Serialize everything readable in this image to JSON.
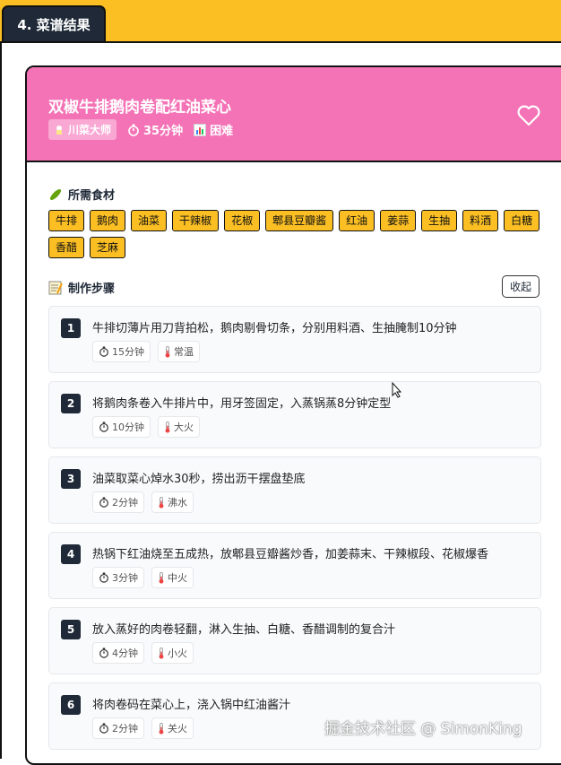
{
  "tab": {
    "label": "4. 菜谱结果"
  },
  "recipe": {
    "title": "双椒牛排鹅肉卷配红油菜心",
    "chef": "川菜大师",
    "time": "35分钟",
    "difficulty": "困难"
  },
  "ingredients": {
    "title": "所需食材",
    "items": [
      "牛排",
      "鹅肉",
      "油菜",
      "干辣椒",
      "花椒",
      "郫县豆瓣酱",
      "红油",
      "姜蒜",
      "生抽",
      "料酒",
      "白糖",
      "香醋",
      "芝麻"
    ]
  },
  "steps": {
    "title": "制作步骤",
    "collapse_label": "收起",
    "items": [
      {
        "num": "1",
        "text": "牛排切薄片用刀背拍松，鹅肉剔骨切条，分别用料酒、生抽腌制10分钟",
        "time": "15分钟",
        "heat": "常温"
      },
      {
        "num": "2",
        "text": "将鹅肉条卷入牛排片中，用牙签固定，入蒸锅蒸8分钟定型",
        "time": "10分钟",
        "heat": "大火"
      },
      {
        "num": "3",
        "text": "油菜取菜心焯水30秒，捞出沥干摆盘垫底",
        "time": "2分钟",
        "heat": "沸水"
      },
      {
        "num": "4",
        "text": "热锅下红油烧至五成热，放郫县豆瓣酱炒香，加姜蒜末、干辣椒段、花椒爆香",
        "time": "3分钟",
        "heat": "中火"
      },
      {
        "num": "5",
        "text": "放入蒸好的肉卷轻翻，淋入生抽、白糖、香醋调制的复合汁",
        "time": "4分钟",
        "heat": "小火"
      },
      {
        "num": "6",
        "text": "将肉卷码在菜心上，浇入锅中红油酱汁",
        "time": "2分钟",
        "heat": "关火"
      }
    ]
  },
  "watermark": "掘金技术社区 @ SimonKing",
  "colors": {
    "accent": "#fbbf24",
    "header_pink": "#f472b6",
    "dark": "#1f2937"
  }
}
